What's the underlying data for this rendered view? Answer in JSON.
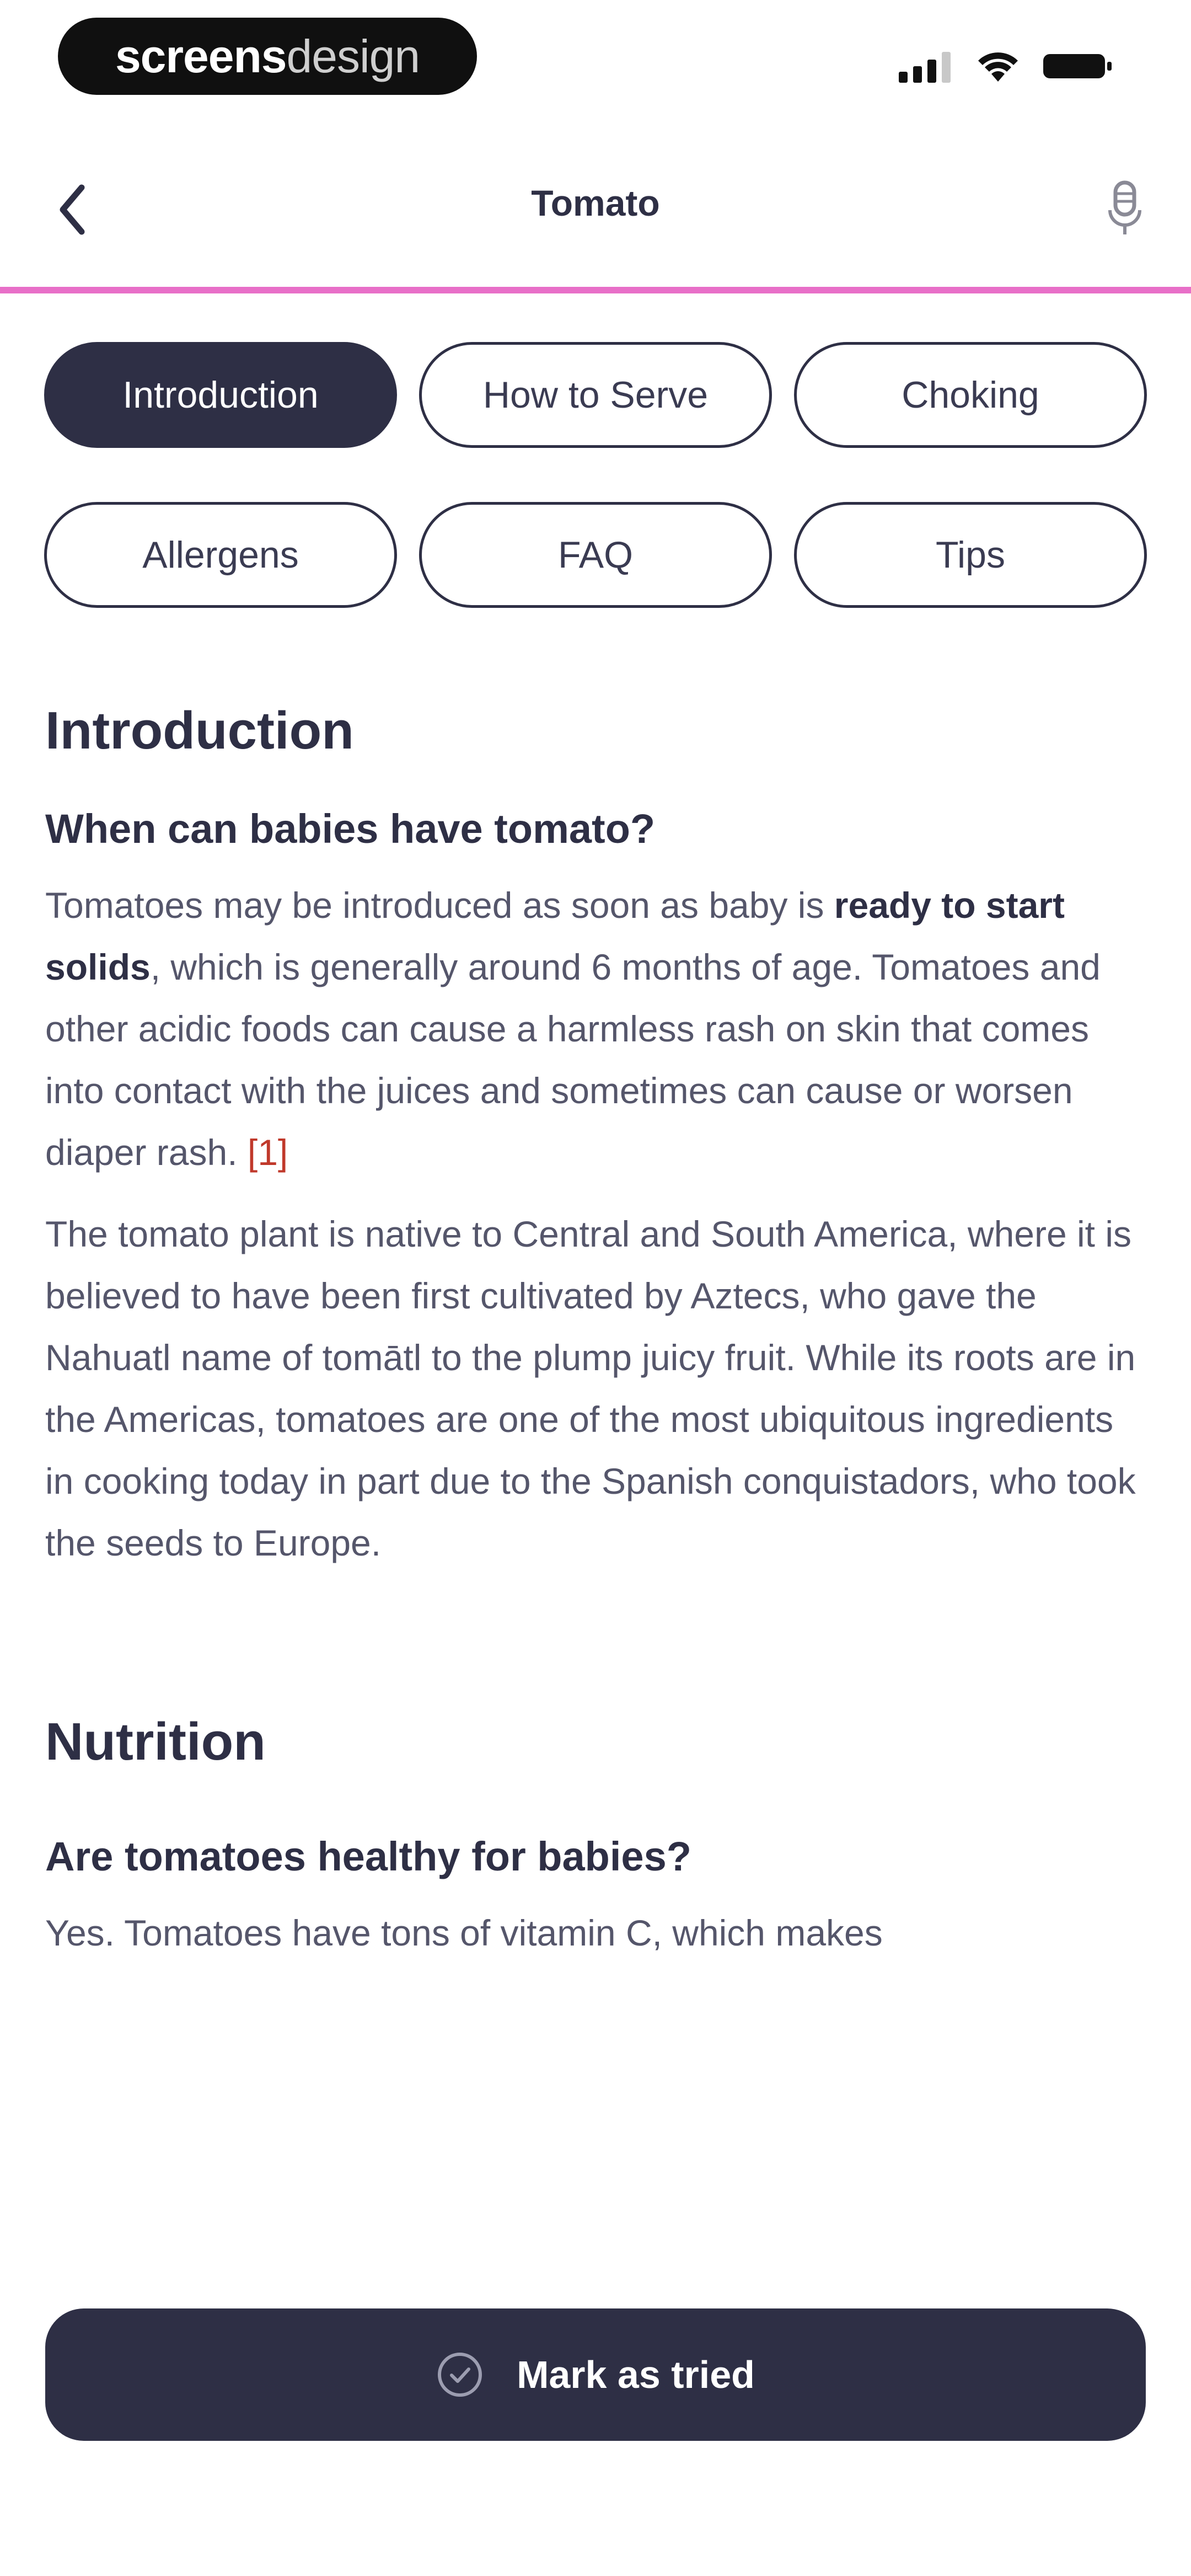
{
  "watermark": {
    "bold": "screens",
    "light": "design"
  },
  "nav": {
    "title": "Tomato"
  },
  "tabs": [
    "Introduction",
    "How to Serve",
    "Choking",
    "Allergens",
    "FAQ",
    "Tips"
  ],
  "active_tab": "Introduction",
  "introduction": {
    "title": "Introduction",
    "question": "When can babies have tomato?",
    "p1_a": "Tomatoes may be introduced as soon as baby is ",
    "p1_strong": "ready to start solids",
    "p1_b": ", which is generally around 6 months of age. Tomatoes and other acidic foods can cause a harmless rash on skin that comes into contact with the juices and sometimes can cause or worsen diaper rash. ",
    "p1_cite": "[1]",
    "p2": "The tomato plant is native to Central and South America, where it is believed to have been first cultivated by Aztecs, who gave the Nahuatl name of tomātl to the plump juicy fruit. While its roots are in the Americas, tomatoes are one of the most ubiquitous ingredients in cooking today in part due to the Spanish conquistadors, who took the seeds to Europe."
  },
  "nutrition": {
    "title": "Nutrition",
    "question": "Are tomatoes healthy for babies?",
    "p1": "Yes. Tomatoes have tons of vitamin C, which makes"
  },
  "cta": {
    "label": "Mark as tried"
  },
  "colors": {
    "primary": "#2e2f45",
    "accent": "#e86fc8",
    "citation": "#c0392b"
  }
}
